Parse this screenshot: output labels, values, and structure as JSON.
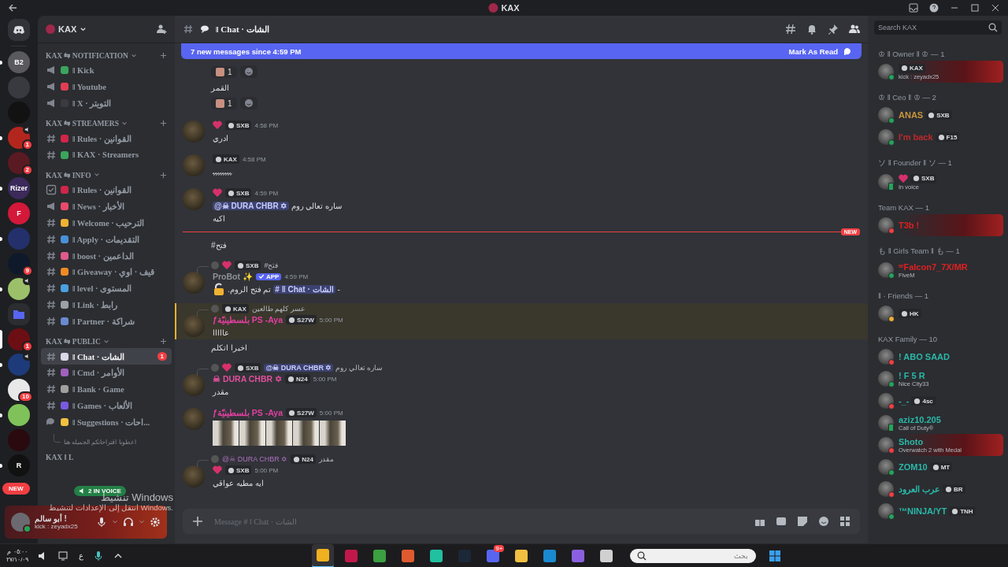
{
  "window": {
    "title": "KAX"
  },
  "servers": [
    {
      "kind": "server",
      "color": "#5a5a5e",
      "label": "B2",
      "unread": true,
      "voice": false,
      "selected": false
    },
    {
      "kind": "server",
      "color": "#393a40",
      "unread": false,
      "voice": false,
      "selected": false
    },
    {
      "kind": "server",
      "color": "#121212",
      "unread": false,
      "voice": false,
      "selected": false
    },
    {
      "kind": "server",
      "color": "#b3261e",
      "badge": "1",
      "unread": true,
      "voice": true,
      "selected": false
    },
    {
      "kind": "server",
      "color": "#5a1a22",
      "badge": "2",
      "unread": false,
      "voice": false,
      "selected": false
    },
    {
      "kind": "server",
      "color": "#3b2a5a",
      "label": "Rizer",
      "unread": true,
      "voice": false,
      "selected": false
    },
    {
      "kind": "server",
      "color": "#d3183a",
      "label": "F",
      "unread": false,
      "voice": false,
      "selected": false
    },
    {
      "kind": "server",
      "color": "#24306b",
      "unread": true,
      "voice": false,
      "selected": false
    },
    {
      "kind": "server",
      "color": "#0e1a2a",
      "badge": "9",
      "unread": false,
      "voice": false,
      "selected": false
    },
    {
      "kind": "server",
      "color": "#9cc06a",
      "unread": true,
      "voice": true,
      "selected": false
    },
    {
      "kind": "folder",
      "color": "#5865f2",
      "unread": false,
      "voice": false,
      "selected": false
    },
    {
      "kind": "server",
      "color": "#6b0f14",
      "badge": "1",
      "unread": false,
      "voice": false,
      "selected": true
    },
    {
      "kind": "server",
      "color": "#1d3a7a",
      "unread": true,
      "voice": true,
      "selected": false
    },
    {
      "kind": "server",
      "color": "#e8e8e8",
      "badge": "10",
      "unread": false,
      "voice": false,
      "selected": false
    },
    {
      "kind": "server",
      "color": "#7fc25a",
      "unread": true,
      "voice": false,
      "selected": false
    },
    {
      "kind": "server",
      "color": "#2a0a0e",
      "unread": false,
      "voice": false,
      "selected": false
    },
    {
      "kind": "server",
      "color": "#111111",
      "label": "R",
      "unread": true,
      "voice": false,
      "selected": false
    }
  ],
  "new_pill": "NEW",
  "server": {
    "name": "KAX"
  },
  "categories": [
    {
      "name": "KAX ⇆ NOTIFICATION",
      "channels": [
        {
          "kind": "announce",
          "name": "‖ Kick",
          "color": "#3ba55c",
          "selected": false
        },
        {
          "kind": "announce",
          "name": "‖ Youtube",
          "color": "#e03e52",
          "selected": false
        },
        {
          "kind": "announce",
          "name": "‖ X · التويتر",
          "color": "#3a3a3f",
          "selected": false
        }
      ]
    },
    {
      "name": "KAX ⇆ STREAMERS",
      "channels": [
        {
          "kind": "text",
          "name": "‖ Rules · القوانين",
          "color": "#d0264a",
          "selected": false
        },
        {
          "kind": "text",
          "name": "‖ KAX · Streamers",
          "color": "#3ba55c",
          "selected": false
        }
      ]
    },
    {
      "name": "KAX ⇆ INFO",
      "channels": [
        {
          "kind": "rules",
          "name": "‖ Rules · القوانين",
          "color": "#d0264a",
          "selected": false
        },
        {
          "kind": "announce",
          "name": "‖ News · الأخبار",
          "color": "#e84a6a",
          "selected": false
        },
        {
          "kind": "text",
          "name": "‖ Welcome · الترحيب",
          "color": "#f0b232",
          "selected": false
        },
        {
          "kind": "text",
          "name": "‖ Apply · التقديمات",
          "color": "#4a90d9",
          "selected": false
        },
        {
          "kind": "text",
          "name": "‖ boost · الداعمين",
          "color": "#e05a8a",
          "selected": false
        },
        {
          "kind": "text",
          "name": "‖ Giveaway · قيف · اوي",
          "color": "#f08a24",
          "selected": false
        },
        {
          "kind": "text",
          "name": "‖ level · المستوى",
          "color": "#4aa0e0",
          "selected": false
        },
        {
          "kind": "text",
          "name": "‖ Link · رابط",
          "color": "#9aa0a6",
          "selected": false
        },
        {
          "kind": "text",
          "name": "‖ Partner · شراكة",
          "color": "#6a8ad0",
          "selected": false
        }
      ]
    },
    {
      "name": "KAX ⇆ PUBLIC",
      "channels": [
        {
          "kind": "text",
          "name": "‖ Chat · الشات",
          "color": "#d8d8e8",
          "selected": true,
          "badge": "1"
        },
        {
          "kind": "text",
          "name": "‖ Cmd · الأوامر",
          "color": "#a060c0",
          "selected": false
        },
        {
          "kind": "text",
          "name": "‖ Bank · Game",
          "color": "#a0a0a0",
          "selected": false
        },
        {
          "kind": "text",
          "name": "‖ Games · الألعاب",
          "color": "#7a5ae0",
          "selected": false
        },
        {
          "kind": "forum",
          "name": "‖ Suggestions · احات...",
          "color": "#f0c040",
          "selected": false,
          "posts": [
            "اعطونا اقتراحاتكم الجميله هنا"
          ]
        }
      ]
    }
  ],
  "partial_category": "KAX ‖ L",
  "voice_pill": "2 IN VOICE",
  "user": {
    "name": "أبو سالم !",
    "status": "kick : zeyadx25"
  },
  "channel_header": {
    "name": "‖ Chat · الشات"
  },
  "banner": {
    "text": "7 new messages since 4:59 PM",
    "action": "Mark As Read"
  },
  "messages": [
    {
      "kind": "reactions",
      "count": "1"
    },
    {
      "kind": "line",
      "parts": [
        {
          "kind": "text",
          "text": "القمر"
        }
      ]
    },
    {
      "kind": "reactions",
      "count": "1"
    },
    {
      "kind": "message",
      "highlighted": false,
      "heart": true,
      "tag": "SXB",
      "time": "4:58 PM",
      "lines": [
        [
          {
            "kind": "text",
            "text": "ادري"
          }
        ]
      ]
    },
    {
      "kind": "message",
      "highlighted": false,
      "heart": false,
      "tag": "KAX",
      "time": "4:58 PM",
      "lines": [
        [
          {
            "kind": "text",
            "text": "ﮩﮩﮩﮩﮩﮩﮩﮩ"
          }
        ]
      ]
    },
    {
      "kind": "message",
      "highlighted": false,
      "heart": true,
      "tag": "SXB",
      "time": "4:59 PM",
      "lines": [
        [
          {
            "kind": "text",
            "text": "ساره تعالي روم"
          },
          {
            "kind": "mention",
            "text": "@☠ DURA CHBR ✡"
          }
        ],
        [
          {
            "kind": "text",
            "text": "اكيه"
          }
        ]
      ]
    },
    {
      "kind": "divider",
      "label": "NEW"
    },
    {
      "kind": "line",
      "parts": [
        {
          "kind": "text",
          "text": "فتح#"
        }
      ]
    },
    {
      "kind": "message",
      "highlighted": false,
      "reply": {
        "heart": true,
        "tag": "SXB",
        "parts": [
          {
            "kind": "text",
            "text": "فتح#"
          }
        ]
      },
      "author": "ProBot ✨",
      "color": "#8e9297",
      "bot": "APP",
      "time": "4:59 PM",
      "lines": [
        [
          {
            "kind": "text",
            "text": "-"
          },
          {
            "kind": "channel",
            "text": "# ‖ Chat · الشات"
          },
          {
            "kind": "text",
            "text": "تم فتح الروم."
          },
          {
            "kind": "lock"
          }
        ]
      ]
    },
    {
      "kind": "message",
      "highlighted": true,
      "reply": {
        "heart": false,
        "tag": "KAX",
        "parts": [
          {
            "kind": "text",
            "text": "عسر كلهم طالعين"
          }
        ]
      },
      "author": "ƒبلسطينيّة PS -Aya",
      "color": "#e040a0",
      "tag": "S27W",
      "time": "5:00 PM",
      "lines": [
        [
          {
            "kind": "text",
            "text": "عااااا"
          }
        ]
      ]
    },
    {
      "kind": "line",
      "parts": [
        {
          "kind": "text",
          "text": "اخيرا اتكلم"
        }
      ]
    },
    {
      "kind": "message",
      "highlighted": false,
      "reply": {
        "heart": true,
        "tag": "SXB",
        "parts": [
          {
            "kind": "text",
            "text": "ساره تعالي روم"
          },
          {
            "kind": "mention",
            "text": "@☠ DURA CHBR ✡"
          }
        ]
      },
      "author": "☠ DURA CHBR ✡",
      "color": "#e0509a",
      "tag": "N24",
      "time": "5:00 PM",
      "lines": [
        [
          {
            "kind": "text",
            "text": "مقدر"
          }
        ]
      ]
    },
    {
      "kind": "message",
      "highlighted": false,
      "author": "ƒبلسطينيّة PS -Aya",
      "color": "#e040a0",
      "tag": "S27W",
      "time": "5:00 PM",
      "photos": [
        {
          "kind": "photo"
        },
        {
          "kind": "photo"
        },
        {
          "kind": "photo"
        },
        {
          "kind": "photo"
        },
        {
          "kind": "photo"
        }
      ]
    },
    {
      "kind": "message",
      "highlighted": false,
      "reply": {
        "heart": false,
        "author": "@☠ DURA CHBR ✡",
        "tag": "N24",
        "parts": [
          {
            "kind": "text",
            "text": "مقدر"
          }
        ]
      },
      "heart": true,
      "tag": "SXB",
      "time": "5:00 PM",
      "lines": [
        [
          {
            "kind": "text",
            "text": "ايه مطيه عواقي"
          }
        ]
      ]
    }
  ],
  "composer": {
    "placeholder": "Message # ‖ Chat · الشات"
  },
  "search": {
    "placeholder": "Search KAX"
  },
  "member_groups": [
    {
      "title": "♔ ‖ Owner ‖ ♔ — 1",
      "members": [
        {
          "tag": "KAX",
          "status": "kick : zeyadx25",
          "color": "#23a55a",
          "mobile": false,
          "banner": true
        }
      ]
    },
    {
      "title": "♔ ‖ Ceo ‖ ♔ — 2",
      "members": [
        {
          "name": {
            "text": "ANAS",
            "color": "#c8963c"
          },
          "tag": "SXB",
          "color": "#23a55a",
          "mobile": false,
          "banner": false
        },
        {
          "name": {
            "text": "I'm back",
            "color": "#c0282a"
          },
          "tag": "F15",
          "color": "#23a55a",
          "mobile": false,
          "banner": false
        }
      ]
    },
    {
      "title": "ソ ‖ Founder ‖ ソ — 1",
      "members": [
        {
          "heart": true,
          "tag": "SXB",
          "status": "In voice",
          "color": "#23a55a",
          "mobile": true,
          "banner": false
        }
      ]
    },
    {
      "title": "Team KAX — 1",
      "members": [
        {
          "name": {
            "text": "T3b !",
            "color": "#e02020"
          },
          "color": "#f23f43",
          "mobile": false,
          "banner": true
        }
      ]
    },
    {
      "title": "も ‖ Girls Team ‖ も — 1",
      "members": [
        {
          "name": {
            "text": "ᵆFalcon7_7X/MR",
            "color": "#e02020"
          },
          "status": "FiveM",
          "color": "#23a55a",
          "mobile": false,
          "banner": false
        }
      ]
    },
    {
      "title": "‖ · Friends — 1",
      "members": [
        {
          "tag": "HK",
          "color": "#f0b232",
          "mobile": false,
          "banner": false
        }
      ]
    },
    {
      "title": "KAX Family — 10",
      "members": [
        {
          "name": {
            "text": "! ABO SAAD",
            "color": "#2ab8a8"
          },
          "color": "#f23f43",
          "mobile": false,
          "banner": false
        },
        {
          "name": {
            "text": "! F 5 R",
            "color": "#2ab8a8"
          },
          "status": "Nice City33",
          "color": "#23a55a",
          "mobile": false,
          "banner": false
        },
        {
          "name": {
            "text": "-_-",
            "color": "#2ab8a8"
          },
          "tag": "4sc",
          "color": "#f23f43",
          "mobile": false,
          "banner": false
        },
        {
          "name": {
            "text": "aziz10.205",
            "color": "#2ab8a8"
          },
          "status": "Call of Duty®",
          "color": "#23a55a",
          "mobile": true,
          "banner": false
        },
        {
          "name": {
            "text": "Shoto",
            "color": "#2ab8a8"
          },
          "status": "Overwatch 2 with Medal",
          "color": "#f23f43",
          "mobile": false,
          "banner": true
        },
        {
          "name": {
            "text": "ZOM10",
            "color": "#2ab8a8"
          },
          "tag": "MT",
          "color": "#23a55a",
          "mobile": false,
          "banner": false
        },
        {
          "name": {
            "text": "عرب العرود",
            "color": "#2ab8a8"
          },
          "tag": "BR",
          "color": "#f23f43",
          "mobile": false,
          "banner": false
        },
        {
          "name": {
            "text": "™NINJA/YT",
            "color": "#2ab8a8"
          },
          "tag": "TNH",
          "color": "#23a55a",
          "mobile": false,
          "banner": false
        }
      ]
    }
  ],
  "activation": {
    "title": "تنشيط Windows",
    "text": "انتقل إلى الإعدادات لتنشيط Windows."
  },
  "taskbar": {
    "time": "٠٥:٠٠ م",
    "date": "٢٧/١٠/٠٩",
    "keyboard": "ع",
    "search": {
      "placeholder": "بحث"
    },
    "apps": [
      {
        "color": "#f0b020",
        "selected": true
      },
      {
        "color": "#c0184a",
        "selected": false
      },
      {
        "color": "#3aa040",
        "selected": false
      },
      {
        "color": "#e05a30",
        "selected": false
      },
      {
        "color": "#20c0a0",
        "selected": false
      },
      {
        "color": "#1b2838",
        "selected": false
      },
      {
        "color": "#5865f2",
        "selected": false,
        "badge": "9+"
      },
      {
        "color": "#f0c040",
        "selected": false
      },
      {
        "color": "#1a8ad0",
        "selected": false
      },
      {
        "color": "#8a60e0",
        "selected": false
      },
      {
        "color": "#d0d0d0",
        "selected": false
      }
    ]
  }
}
